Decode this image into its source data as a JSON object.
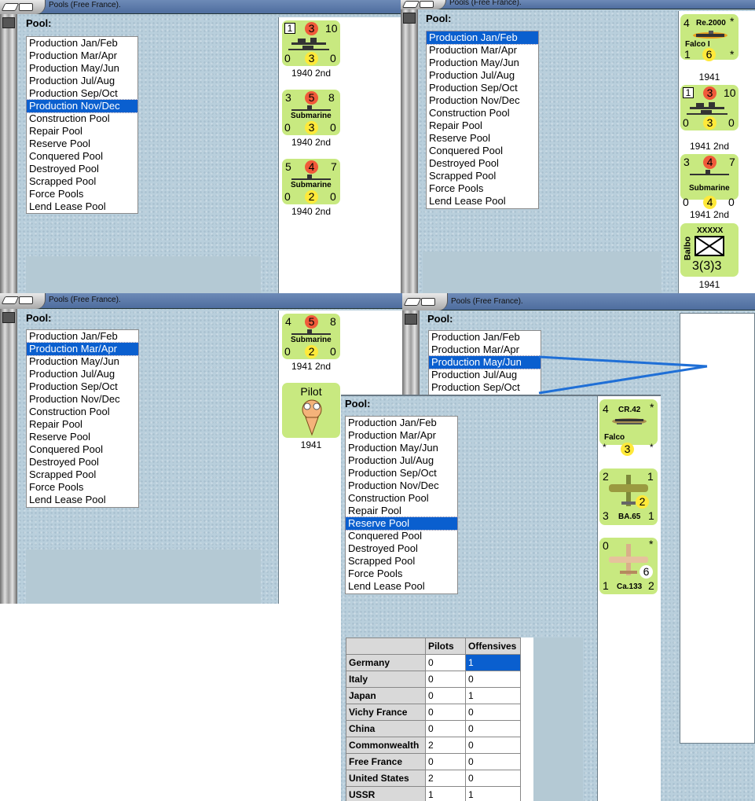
{
  "window_title": "Pools (Free France).",
  "pool_label": "Pool:",
  "pool_items": [
    "Production Jan/Feb",
    "Production Mar/Apr",
    "Production May/Jun",
    "Production Jul/Aug",
    "Production Sep/Oct",
    "Production Nov/Dec",
    "Construction Pool",
    "Repair Pool",
    "Reserve Pool",
    "Conquered Pool",
    "Destroyed Pool",
    "Scrapped Pool",
    "Force Pools",
    "Lend Lease Pool"
  ],
  "pool_items_partial": [
    "Production Jan/Feb",
    "Production Mar/Apr",
    "Production May/Jun",
    "Production Jul/Aug",
    "Production Sep/Oct"
  ],
  "panels": {
    "top_left": {
      "selected": "Production Nov/Dec"
    },
    "top_right": {
      "selected": "Production Jan/Feb"
    },
    "bottom_left": {
      "selected": "Production Mar/Apr"
    },
    "bottom_right": {
      "selected": "Production May/Jun"
    },
    "front": {
      "selected": "Reserve Pool"
    }
  },
  "counters": {
    "tl_1": {
      "box": "1",
      "mid": "3",
      "right": "10",
      "bl": "0",
      "bm": "3",
      "br": "0",
      "caption": "1940 2nd"
    },
    "tl_2": {
      "tl": "3",
      "mid": "5",
      "right": "8",
      "name": "Submarine",
      "bl": "0",
      "bm": "3",
      "br": "0",
      "caption": "1940 2nd"
    },
    "tl_3": {
      "tl": "5",
      "mid": "4",
      "right": "7",
      "name": "Submarine",
      "bl": "0",
      "bm": "2",
      "br": "0",
      "caption": "1940 2nd"
    },
    "tr_1": {
      "tl": "4",
      "type": "Re.2000",
      "star": "*",
      "name": "Falco I",
      "bl": "1",
      "bm": "6",
      "br": "*",
      "caption": "1941"
    },
    "tr_2": {
      "box": "1",
      "mid": "3",
      "right": "10",
      "bl": "0",
      "bm": "3",
      "br": "0",
      "caption": "1941 2nd"
    },
    "tr_3": {
      "tl": "3",
      "mid": "4",
      "right": "7",
      "name": "Submarine",
      "bl": "0",
      "bm": "4",
      "br": "0",
      "caption": "1941 2nd"
    },
    "tr_4": {
      "name": "Balbo",
      "size": "XXXXX",
      "value": "3(3)3",
      "caption": "1941"
    },
    "bl_1": {
      "tl": "4",
      "mid": "5",
      "right": "8",
      "name": "Submarine",
      "bl": "0",
      "bm": "2",
      "br": "0",
      "caption": "1941 2nd"
    },
    "bl_2": {
      "title": "Pilot",
      "caption": "1941"
    },
    "fr_1": {
      "tl": "4",
      "type": "CR.42",
      "star": "*",
      "name": "Falco",
      "bl": "*",
      "bm": "3",
      "br": "*"
    },
    "fr_2": {
      "tl": "2",
      "tr": "1",
      "mid": "2",
      "bl": "3",
      "type": "BA.65",
      "br": "1"
    },
    "fr_3": {
      "tl": "0",
      "tr": "*",
      "mid": "6",
      "bl": "1",
      "type": "Ca.133",
      "br": "2"
    }
  },
  "table": {
    "headers": [
      "",
      "Pilots",
      "Offensives"
    ],
    "rows": [
      {
        "country": "Germany",
        "pilots": "0",
        "offensives": "1"
      },
      {
        "country": "Italy",
        "pilots": "0",
        "offensives": "0"
      },
      {
        "country": "Japan",
        "pilots": "0",
        "offensives": "1"
      },
      {
        "country": "Vichy France",
        "pilots": "0",
        "offensives": "0"
      },
      {
        "country": "China",
        "pilots": "0",
        "offensives": "0"
      },
      {
        "country": "Commonwealth",
        "pilots": "2",
        "offensives": "0"
      },
      {
        "country": "Free France",
        "pilots": "0",
        "offensives": "0"
      },
      {
        "country": "United States",
        "pilots": "2",
        "offensives": "0"
      },
      {
        "country": "USSR",
        "pilots": "1",
        "offensives": "1"
      }
    ]
  },
  "colors": {
    "counter_green": "#c8e980",
    "selection_blue": "#0a5fcf",
    "red_circle": "#f05a3a",
    "yellow_circle": "#ffe93a",
    "arrow_blue": "#1f6fd6"
  }
}
